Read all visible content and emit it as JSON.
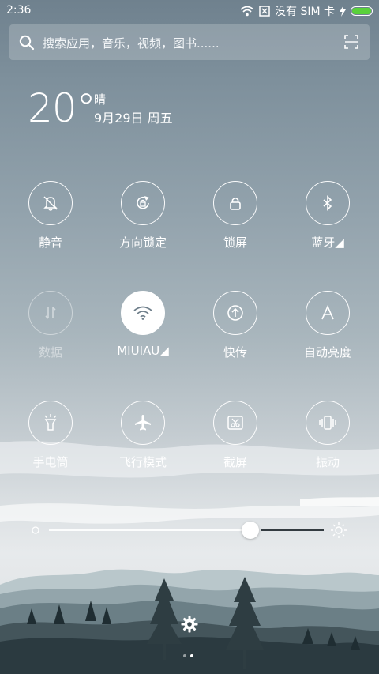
{
  "status_bar": {
    "time": "2:36",
    "sim_text": "没有 SIM 卡",
    "icons": [
      "wifi-icon",
      "sim-missing-icon",
      "charging-icon",
      "battery-icon"
    ],
    "battery_color": "#5ad13c"
  },
  "search": {
    "placeholder": "搜索应用，音乐，视频，图书......",
    "icons": [
      "search-icon",
      "scan-icon"
    ]
  },
  "weather": {
    "temperature": "20°",
    "condition": "晴",
    "date": "9月29日 周五"
  },
  "toggles": [
    {
      "label": "静音",
      "icon": "mute-icon",
      "state": "off"
    },
    {
      "label": "方向锁定",
      "icon": "rotation-lock-icon",
      "state": "off"
    },
    {
      "label": "锁屏",
      "icon": "lock-icon",
      "state": "off"
    },
    {
      "label": "蓝牙◢",
      "icon": "bluetooth-icon",
      "state": "off"
    },
    {
      "label": "数据",
      "icon": "data-icon",
      "state": "disabled"
    },
    {
      "label": "MIUIAU◢",
      "icon": "wifi-icon",
      "state": "on"
    },
    {
      "label": "快传",
      "icon": "quick-transfer-icon",
      "state": "off"
    },
    {
      "label": "自动亮度",
      "icon": "auto-brightness-icon",
      "state": "off"
    },
    {
      "label": "手电筒",
      "icon": "flashlight-icon",
      "state": "off"
    },
    {
      "label": "飞行模式",
      "icon": "airplane-icon",
      "state": "off"
    },
    {
      "label": "截屏",
      "icon": "screenshot-icon",
      "state": "off"
    },
    {
      "label": "振动",
      "icon": "vibrate-icon",
      "state": "off"
    }
  ],
  "brightness": {
    "level": 0.75,
    "icons": [
      "brightness-low-icon",
      "brightness-high-icon"
    ]
  },
  "settings_icon": "gear-icon",
  "pager": {
    "pages": 2,
    "current": 2
  },
  "colors": {
    "active_tile": "#ffffff",
    "wifi_icon_active": "#6f7f8b"
  }
}
